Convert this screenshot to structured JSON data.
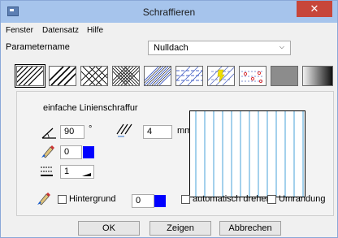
{
  "window": {
    "title": "Schraffieren",
    "close_glyph": "✕"
  },
  "menu": {
    "items": [
      "Fenster",
      "Datensatz",
      "Hilfe"
    ]
  },
  "param": {
    "label": "Parametername",
    "value": "Nulldach"
  },
  "patterns": [
    {
      "name": "diagonal-dense"
    },
    {
      "name": "diagonal"
    },
    {
      "name": "crosshatch-diagonal"
    },
    {
      "name": "crosshatch-dense"
    },
    {
      "name": "blue-diagonal"
    },
    {
      "name": "blue-diagonal-dashed"
    },
    {
      "name": "yellow-symbol"
    },
    {
      "name": "blue-red-dots"
    },
    {
      "name": "gray-fill"
    },
    {
      "name": "gradient-fill"
    }
  ],
  "panel": {
    "caption": "einfache Linienschraffur",
    "angle_value": "90",
    "angle_unit": "°",
    "spacing_value": "4",
    "spacing_unit": "mm",
    "pen_color_value": "0",
    "line_width_value": "1",
    "background_label": "Hintergrund",
    "background_color_value": "0",
    "auto_rotate_label": "automatisch drehen",
    "border_label": "Umrandung"
  },
  "colors": {
    "pen": "#0000ff",
    "preview_lines": "#4aa3d8"
  },
  "buttons": {
    "ok": "OK",
    "show": "Zeigen",
    "cancel": "Abbrechen"
  }
}
